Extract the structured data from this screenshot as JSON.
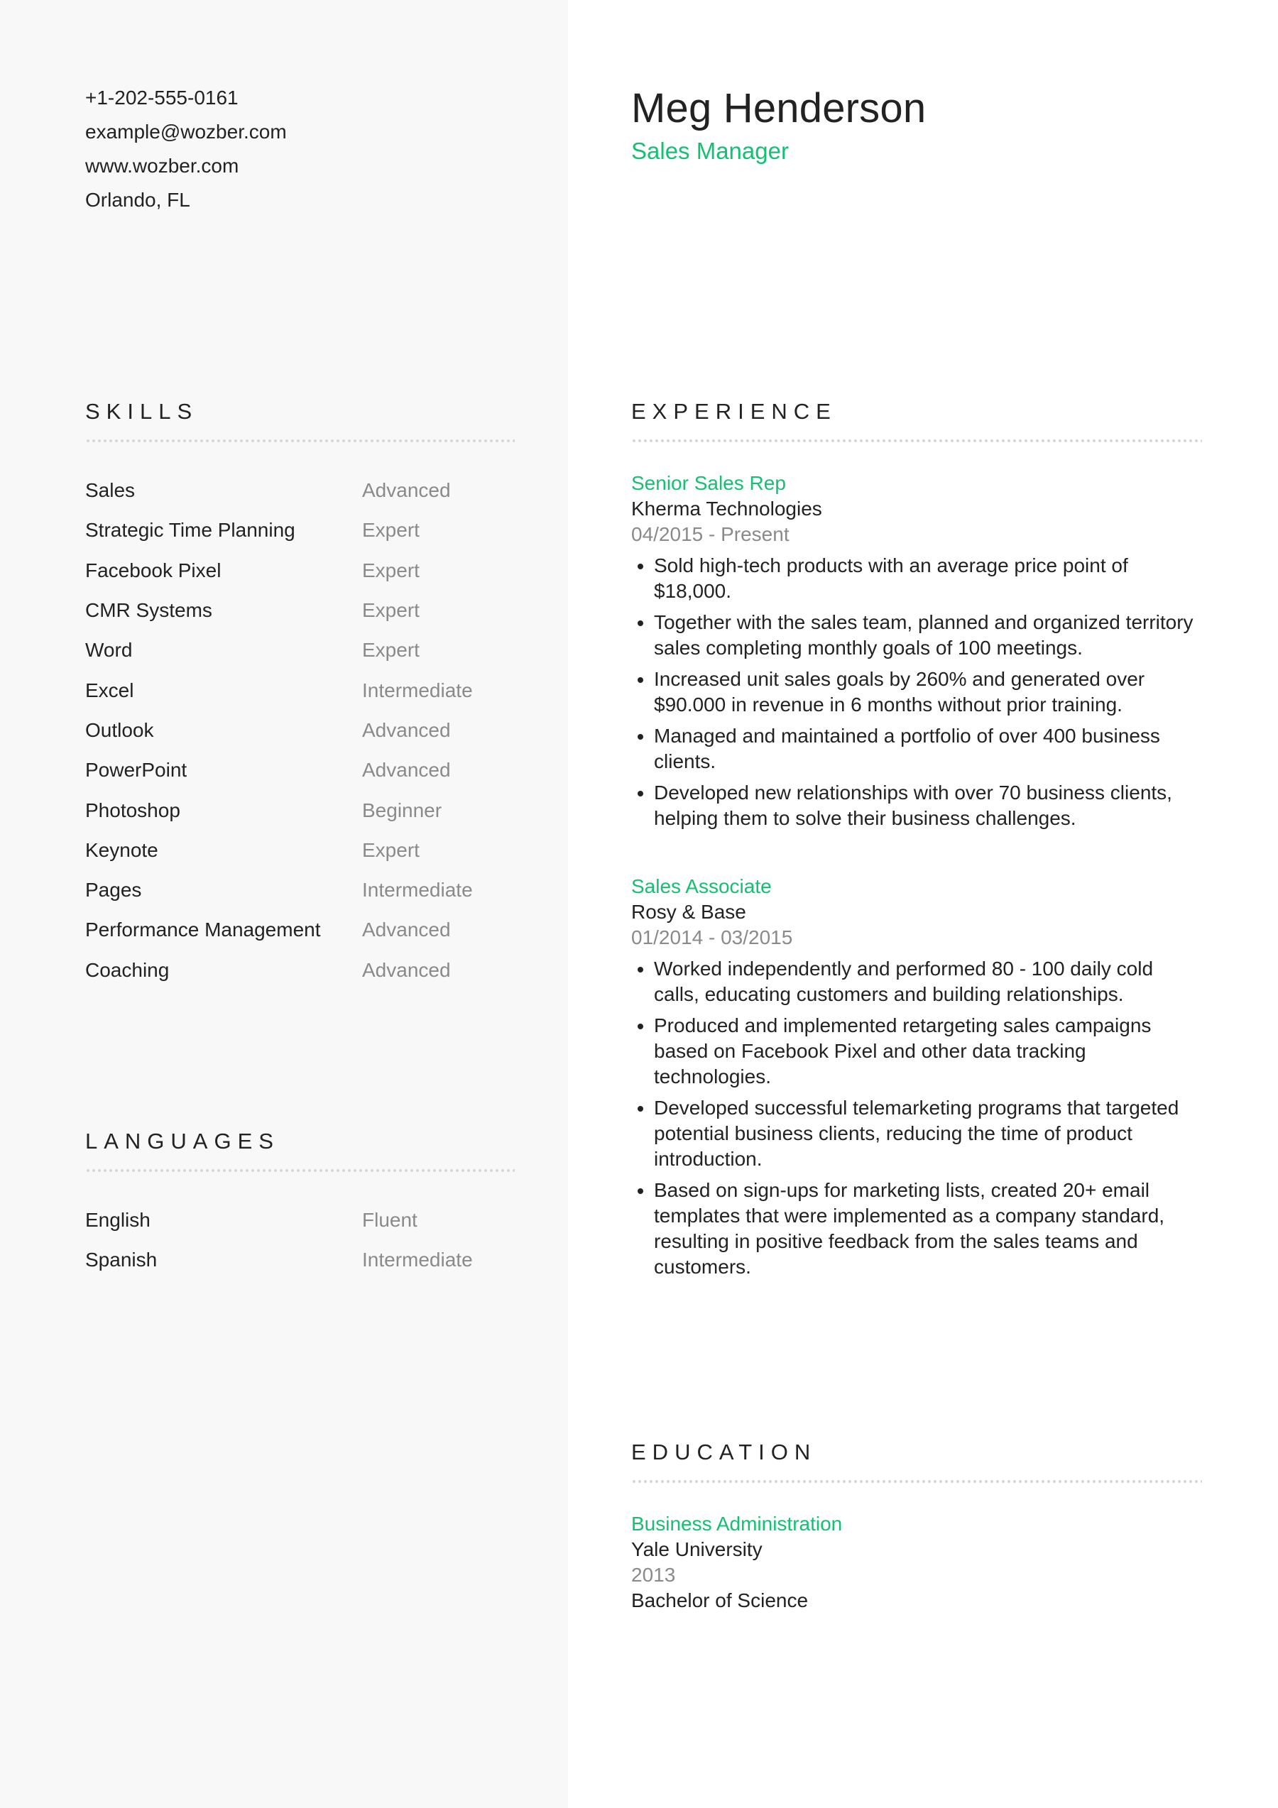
{
  "contact": {
    "phone": "+1-202-555-0161",
    "email": "example@wozber.com",
    "website": "www.wozber.com",
    "location": "Orlando, FL"
  },
  "header": {
    "name": "Meg Henderson",
    "role": "Sales Manager"
  },
  "colors": {
    "accent": "#16c072",
    "sidebar_bg": "#f8f8f8",
    "text": "#222222",
    "muted": "#8a8a8a",
    "divider": "#d6d6d6"
  },
  "skills": {
    "title": "SKILLS",
    "items": [
      {
        "name": "Sales",
        "level": "Advanced"
      },
      {
        "name": "Strategic Time Planning",
        "level": "Expert"
      },
      {
        "name": "Facebook Pixel",
        "level": "Expert"
      },
      {
        "name": "CMR Systems",
        "level": "Expert"
      },
      {
        "name": "Word",
        "level": "Expert"
      },
      {
        "name": "Excel",
        "level": "Intermediate"
      },
      {
        "name": "Outlook",
        "level": "Advanced"
      },
      {
        "name": "PowerPoint",
        "level": "Advanced"
      },
      {
        "name": "Photoshop",
        "level": "Beginner"
      },
      {
        "name": "Keynote",
        "level": "Expert"
      },
      {
        "name": "Pages",
        "level": "Intermediate"
      },
      {
        "name": "Performance Management",
        "level": "Advanced"
      },
      {
        "name": "Coaching",
        "level": "Advanced"
      }
    ]
  },
  "languages": {
    "title": "LANGUAGES",
    "items": [
      {
        "name": "English",
        "level": "Fluent"
      },
      {
        "name": "Spanish",
        "level": "Intermediate"
      }
    ]
  },
  "experience": {
    "title": "EXPERIENCE",
    "jobs": [
      {
        "title": "Senior Sales Rep",
        "company": "Kherma Technologies",
        "dates": "04/2015 - Present",
        "bullets": [
          "Sold high-tech products with an average price point of $18,000.",
          "Together with the sales team, planned and organized territory sales completing monthly goals of 100 meetings.",
          "Increased unit sales goals by 260% and generated over $90.000 in revenue in 6 months without prior training.",
          "Managed and maintained a portfolio of over 400 business clients.",
          "Developed new relationships with over 70 business clients, helping them to solve their business challenges."
        ]
      },
      {
        "title": "Sales Associate",
        "company": "Rosy & Base",
        "dates": "01/2014 - 03/2015",
        "bullets": [
          "Worked independently and performed 80 - 100 daily cold calls, educating customers and building relationships.",
          "Produced and implemented retargeting sales campaigns based on Facebook Pixel and other data tracking technologies.",
          "Developed successful telemarketing programs that targeted potential business clients, reducing the time of product introduction.",
          "Based on sign-ups for marketing lists, created 20+ email templates that were implemented as a company standard, resulting in positive feedback from the sales teams and customers."
        ]
      }
    ]
  },
  "education": {
    "title": "EDUCATION",
    "entries": [
      {
        "field": "Business Administration",
        "school": "Yale University",
        "year": "2013",
        "degree": "Bachelor of Science"
      }
    ]
  }
}
